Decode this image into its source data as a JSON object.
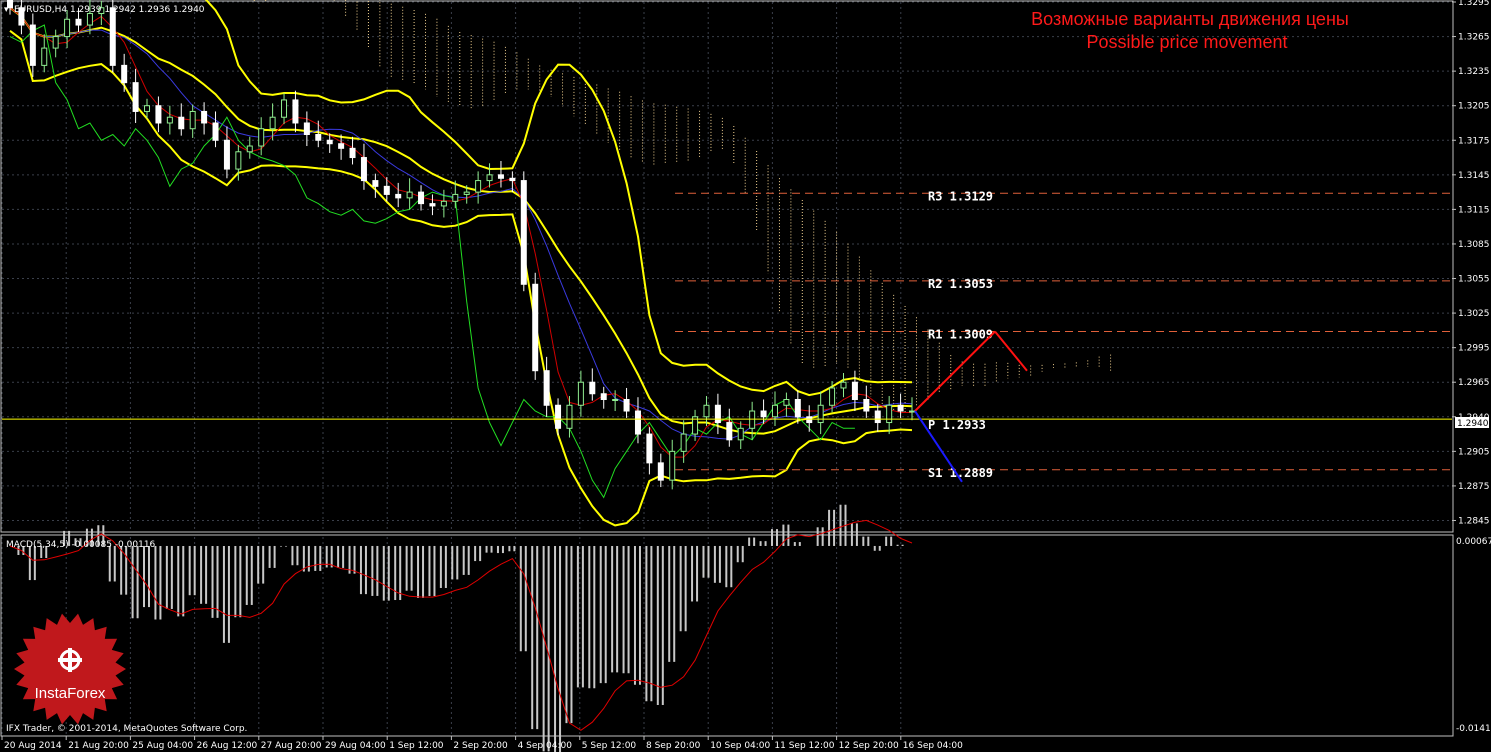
{
  "window": {
    "symbol_header": "EURUSD,H4  1.2939 1.2942 1.2936 1.2940",
    "copyright": "IFX Trader, © 2001-2014, MetaQuotes Software Corp.",
    "logo_text": "InstaForex"
  },
  "annotation": {
    "line_ru": "Возможные варианты движения цены",
    "line_en": "Possible price movement"
  },
  "chart_data": [
    {
      "type": "candlestick",
      "title": "EURUSD,H4",
      "ohlc_header": {
        "open": 1.2939,
        "high": 1.2942,
        "low": 1.2936,
        "close": 1.294
      },
      "current_price": 1.294,
      "current_price_label": "1.2940",
      "ylim": [
        1.2835,
        1.3295
      ],
      "y_ticks": [
        "1.3295",
        "1.3265",
        "1.3235",
        "1.3205",
        "1.3175",
        "1.3145",
        "1.3115",
        "1.3085",
        "1.3055",
        "1.3025",
        "1.2995",
        "1.2965",
        "1.2940",
        "1.2905",
        "1.2875",
        "1.2845"
      ],
      "y_tick_values": [
        1.3295,
        1.3265,
        1.3235,
        1.3205,
        1.3175,
        1.3145,
        1.3115,
        1.3085,
        1.3055,
        1.3025,
        1.2995,
        1.2965,
        1.2935,
        1.2905,
        1.2875,
        1.2845
      ],
      "x_ticks": [
        "20 Aug 2014",
        "21 Aug 20:00",
        "25 Aug 04:00",
        "26 Aug 12:00",
        "27 Aug 20:00",
        "29 Aug 04:00",
        "1 Sep 12:00",
        "2 Sep 20:00",
        "4 Sep 04:00",
        "5 Sep 12:00",
        "8 Sep 20:00",
        "10 Sep 04:00",
        "11 Sep 12:00",
        "12 Sep 20:00",
        "16 Sep 04:00"
      ],
      "pivot_levels": [
        {
          "label": "R3",
          "value": 1.3129,
          "text": "R3  1.3129"
        },
        {
          "label": "R2",
          "value": 1.3053,
          "text": "R2  1.3053"
        },
        {
          "label": "R1",
          "value": 1.3009,
          "text": "R1  1.3009"
        },
        {
          "label": "P",
          "value": 1.2933,
          "text": "P  1.2933"
        },
        {
          "label": "S1",
          "value": 1.2889,
          "text": "S1  1.2889"
        }
      ],
      "forecast": {
        "up": [
          [
            1.294,
            1.3009
          ],
          [
            1.3009,
            1.2975
          ]
        ],
        "down": [
          [
            1.294,
            1.2889
          ]
        ]
      },
      "closes": [
        1.329,
        1.3275,
        1.324,
        1.3255,
        1.3265,
        1.328,
        1.3275,
        1.3285,
        1.329,
        1.324,
        1.3225,
        1.32,
        1.3205,
        1.319,
        1.3195,
        1.3185,
        1.32,
        1.319,
        1.3175,
        1.315,
        1.3165,
        1.317,
        1.3185,
        1.3195,
        1.321,
        1.319,
        1.318,
        1.3175,
        1.3172,
        1.3168,
        1.316,
        1.314,
        1.3135,
        1.3128,
        1.3125,
        1.313,
        1.312,
        1.3118,
        1.3122,
        1.3128,
        1.313,
        1.314,
        1.3145,
        1.3142,
        1.314,
        1.305,
        1.2975,
        1.2945,
        1.2925,
        1.2945,
        1.2965,
        1.2955,
        1.295,
        1.295,
        1.294,
        1.292,
        1.2895,
        1.288,
        1.2905,
        1.292,
        1.2935,
        1.2945,
        1.293,
        1.2915,
        1.2925,
        1.294,
        1.2935,
        1.2945,
        1.295,
        1.2935,
        1.293,
        1.2945,
        1.296,
        1.2965,
        1.295,
        1.294,
        1.293,
        1.2945,
        1.294,
        1.294
      ]
    },
    {
      "type": "macd",
      "title": "MACD(5,34,5) -0.00085 -0.00116",
      "params": [
        5,
        34,
        5
      ],
      "histogram_last": -0.00085,
      "signal_last": -0.00116,
      "y_top_label": "0.00067",
      "y_bottom_label": "-0.01413",
      "ylim": [
        -0.01413,
        0.00067
      ]
    }
  ],
  "colors": {
    "background": "#000000",
    "grid": "#3a3f4a",
    "bull_candle": "#90ee90",
    "bear_candle": "#ffffff",
    "bollinger": "#ffff00",
    "kijun": "#3a3adf",
    "tenkan": "#d00000",
    "chikou": "#22dd22",
    "cloud": "#f0d090",
    "pivot": "#e0603a",
    "forecast_up": "#ff1111",
    "forecast_down": "#1a1aff",
    "annotation": "#ff1a1a",
    "macd_hist": "#c8c8c8",
    "macd_signal": "#e00000"
  }
}
